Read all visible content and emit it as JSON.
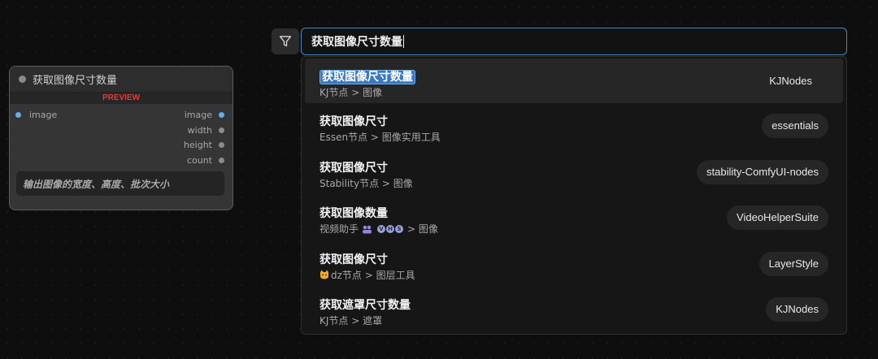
{
  "node": {
    "title": "获取图像尺寸数量",
    "preview_label": "PREVIEW",
    "input": "image",
    "outputs": [
      "image",
      "width",
      "height",
      "count"
    ],
    "description": "输出图像的宽度、高度、批次大小"
  },
  "search": {
    "value": "获取图像尺寸数量"
  },
  "results": [
    {
      "title": "获取图像尺寸数量",
      "category": "KJ节点 > 图像",
      "source": "KJNodes",
      "selected": true
    },
    {
      "title": "获取图像尺寸",
      "category": "Essen节点 > 图像实用工具",
      "source": "essentials"
    },
    {
      "title": "获取图像尺寸",
      "category": "Stability节点 > 图像",
      "source": "stability-ComfyUI-nodes"
    },
    {
      "title": "获取图像数量",
      "category_pre": "视频助手",
      "category_vhs": [
        "V",
        "H",
        "S"
      ],
      "category_post": "> 图像",
      "source": "VideoHelperSuite"
    },
    {
      "title": "获取图像尺寸",
      "category": "dz节点 > 图层工具",
      "source": "LayerStyle"
    },
    {
      "title": "获取遮罩尺寸数量",
      "category": "KJ节点 > 遮罩",
      "source": "KJNodes"
    }
  ]
}
